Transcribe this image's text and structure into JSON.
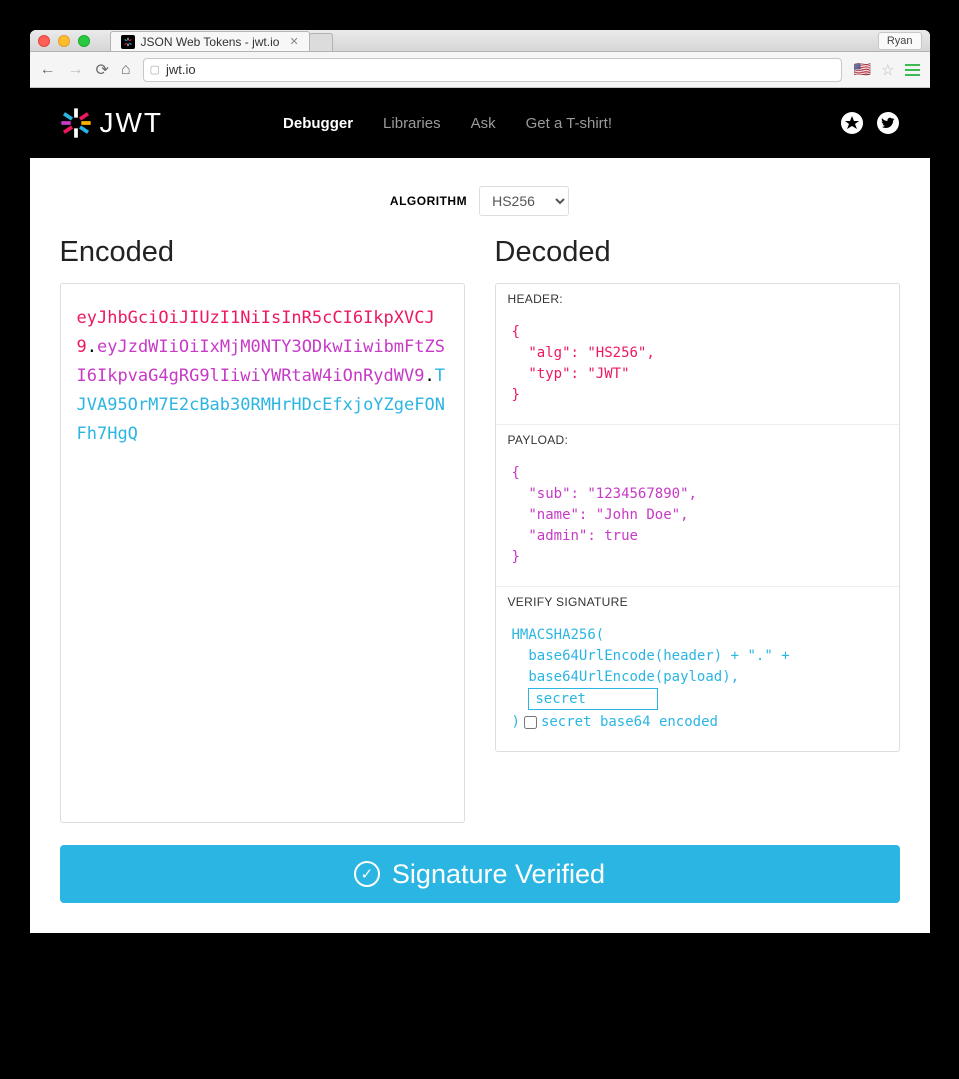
{
  "browser": {
    "tab_title": "JSON Web Tokens - jwt.io",
    "profile": "Ryan",
    "url": "jwt.io"
  },
  "header": {
    "brand": "JWT",
    "nav": {
      "debugger": "Debugger",
      "libraries": "Libraries",
      "ask": "Ask",
      "tshirt": "Get a T-shirt!"
    }
  },
  "algorithm": {
    "label": "ALGORITHM",
    "selected": "HS256"
  },
  "sections": {
    "encoded": "Encoded",
    "decoded": "Decoded"
  },
  "token": {
    "header": "eyJhbGciOiJIUzI1NiIsInR5cCI6IkpXVCJ9",
    "payload": "eyJzdWIiOiIxMjM0NTY3ODkwIiwibmFtZSI6IkpvaG4gRG9lIiwiYWRtaW4iOnRydWV9",
    "signature": "TJVA95OrM7E2cBab30RMHrHDcEfxjoYZgeFONFh7HgQ"
  },
  "decoded": {
    "header_label": "HEADER:",
    "header": {
      "l1": "{",
      "l2": "  \"alg\": \"HS256\",",
      "l3": "  \"typ\": \"JWT\"",
      "l4": "}"
    },
    "payload_label": "PAYLOAD:",
    "payload": {
      "l1": "{",
      "l2": "  \"sub\": \"1234567890\",",
      "l3": "  \"name\": \"John Doe\",",
      "l4": "  \"admin\": true",
      "l5": "}"
    },
    "sig_label": "VERIFY SIGNATURE",
    "sig": {
      "l1": "HMACSHA256(",
      "l2": "  base64UrlEncode(header) + \".\" +",
      "l3": "  base64UrlEncode(payload),",
      "secret": "secret",
      "l5": ") ",
      "cb_label": "secret base64 encoded"
    }
  },
  "verify": "Signature Verified"
}
